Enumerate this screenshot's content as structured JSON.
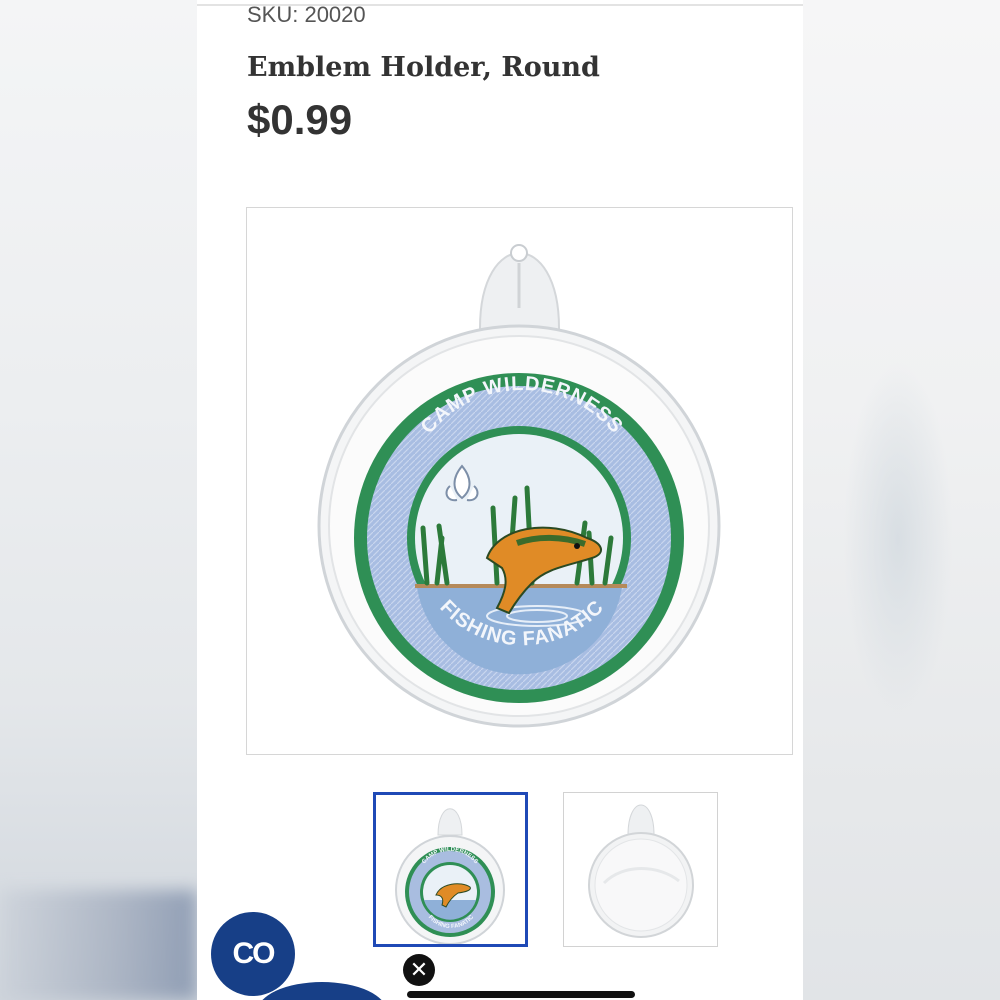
{
  "product": {
    "sku_label": "SKU: 20020",
    "title": "Emblem Holder, Round",
    "price": "$0.99"
  },
  "patch": {
    "top_text": "CAMP WILDERNESS",
    "bottom_text": "FISHING FANATIC",
    "thumb_top_text": "CAMP WILDERNESS",
    "thumb_bottom_text": "FISHING FANATIC"
  },
  "chat": {
    "label": "CO",
    "icon": "chat-logo-icon"
  },
  "close": {
    "glyph": "✕",
    "icon": "close-icon"
  },
  "colors": {
    "accent_border": "#1f49b6",
    "chat_bg": "#173f87",
    "patch_green": "#2f8f55",
    "patch_blue": "#a9bde0"
  }
}
